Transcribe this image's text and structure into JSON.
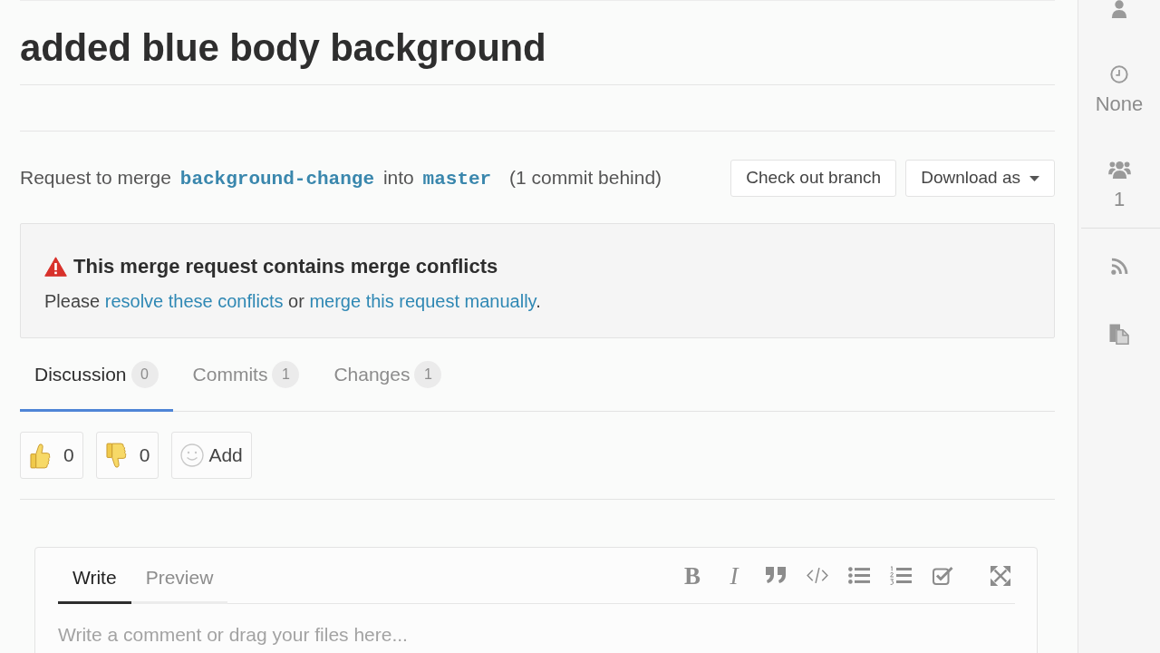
{
  "title": "added blue body background",
  "merge_info": [
    {
      "kind": "text",
      "text": "Request to merge"
    },
    {
      "kind": "branch",
      "text": "background-change"
    },
    {
      "kind": "text",
      "text": "into"
    },
    {
      "kind": "branch",
      "text": "master"
    },
    {
      "kind": "note",
      "text": "(1 commit behind)"
    }
  ],
  "actions": [
    {
      "kind": "button",
      "label": "Check out branch"
    },
    {
      "kind": "dropdown",
      "label": "Download as"
    }
  ],
  "alert": {
    "kind": "warning",
    "title": "This merge request contains merge conflicts",
    "message": [
      {
        "kind": "text",
        "text": "Please "
      },
      {
        "kind": "link",
        "text": "resolve these conflicts"
      },
      {
        "kind": "text",
        "text": " or "
      },
      {
        "kind": "link",
        "text": "merge this request manually"
      },
      {
        "kind": "text",
        "text": "."
      }
    ]
  },
  "tabs": [
    {
      "label": "Discussion",
      "count": "0",
      "selected": true
    },
    {
      "label": "Commits",
      "count": "1",
      "selected": false
    },
    {
      "label": "Changes",
      "count": "1",
      "selected": false
    }
  ],
  "awards": [
    {
      "kind": "thumbs_up",
      "count": "0"
    },
    {
      "kind": "thumbs_down",
      "count": "0"
    },
    {
      "kind": "add",
      "label": "Add"
    }
  ],
  "comment_form": {
    "tabs": [
      {
        "label": "Write",
        "selected": true
      },
      {
        "label": "Preview",
        "selected": false
      }
    ],
    "toolbar": [
      {
        "kind": "bold",
        "glyph": "B"
      },
      {
        "kind": "italic",
        "glyph": "I"
      },
      {
        "kind": "quote"
      },
      {
        "kind": "code"
      },
      {
        "kind": "bullet_list"
      },
      {
        "kind": "numbered_list"
      },
      {
        "kind": "task_list"
      },
      {
        "kind": "fullscreen"
      }
    ],
    "placeholder": "Write a comment or drag your files here..."
  },
  "sidebar": [
    {
      "kind": "assignee"
    },
    {
      "kind": "milestone",
      "value": "None"
    },
    {
      "kind": "participants",
      "value": "1"
    },
    {
      "kind": "rss"
    },
    {
      "kind": "copy"
    }
  ]
}
